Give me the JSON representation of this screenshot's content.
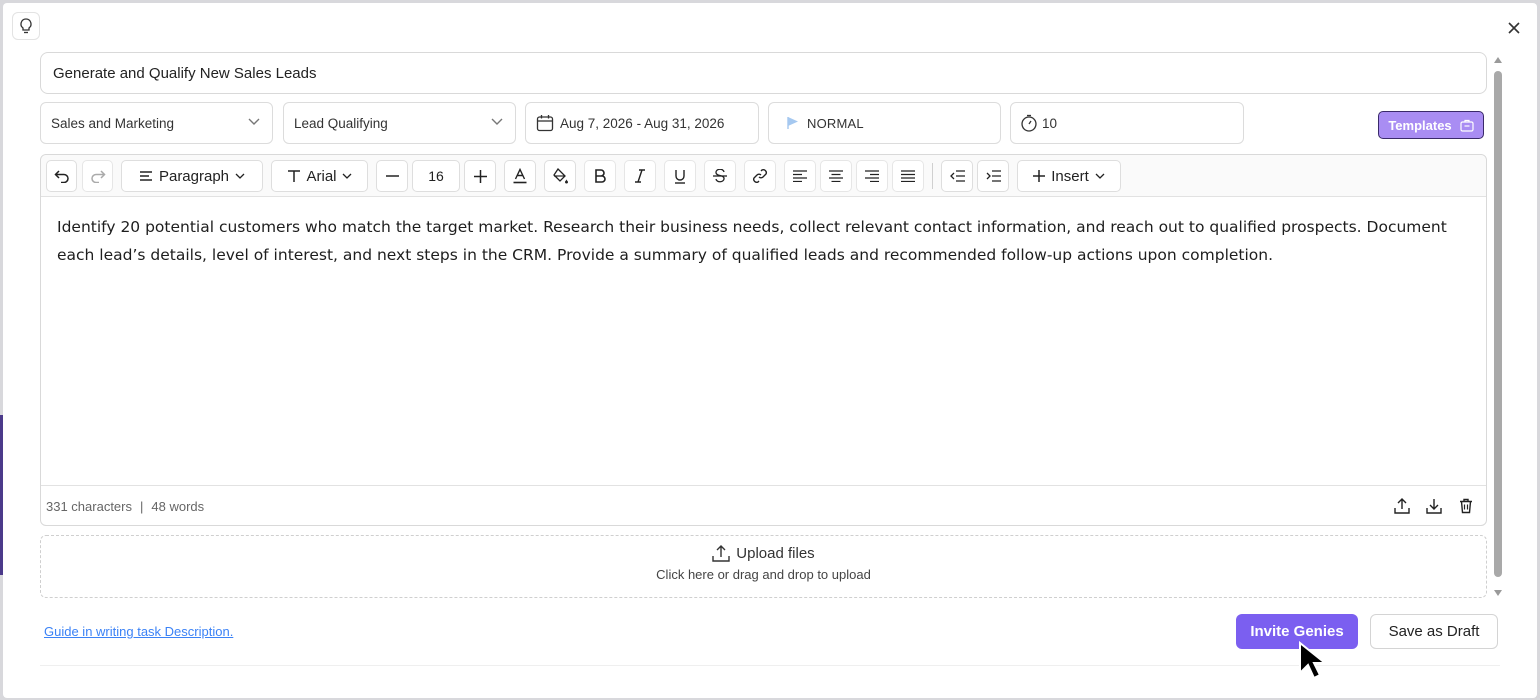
{
  "task": {
    "title": "Generate and Qualify New Sales Leads",
    "category": "Sales and Marketing",
    "subcategory": "Lead Qualifying",
    "date_range": "Aug 7, 2026 - Aug 31, 2026",
    "priority": "NORMAL",
    "duration": "10"
  },
  "templates_label": "Templates",
  "toolbar": {
    "block_format": "Paragraph",
    "font": "Arial",
    "font_size": "16",
    "insert_label": "Insert",
    "icons": [
      "undo-icon",
      "redo-icon",
      "paragraph-icon",
      "font-icon",
      "minus-icon",
      "plus-icon",
      "text-color-icon",
      "highlight-icon",
      "bold-icon",
      "italic-icon",
      "underline-icon",
      "strikethrough-icon",
      "link-icon",
      "align-left-icon",
      "align-center-icon",
      "align-right-icon",
      "justify-icon",
      "outdent-icon",
      "indent-icon",
      "insert-plus-icon"
    ]
  },
  "editor": {
    "body": "Identify 20 potential customers who match the target market. Research their business needs, collect relevant contact information, and reach out to qualified prospects. Document each lead’s details, level of interest, and next steps in the CRM. Provide a summary of qualified leads and recommended follow-up actions upon completion.",
    "char_count": "331 characters",
    "separator": "|",
    "word_count": "48 words"
  },
  "upload": {
    "label": "Upload files",
    "hint": "Click here or drag and drop to upload"
  },
  "footer": {
    "guide_link": "Guide in writing task Description.",
    "invite_label": "Invite Genies",
    "draft_label": "Save as Draft"
  },
  "colors": {
    "accent": "#7b5ff0",
    "templates_bg": "#a98df3",
    "priority_flag": "#a5c8f0",
    "link": "#3b82f6"
  }
}
